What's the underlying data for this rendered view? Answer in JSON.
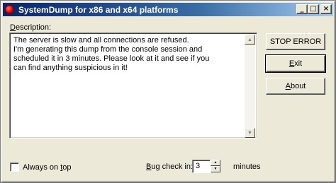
{
  "window": {
    "title": "SystemDump for x86 and x64 platforms",
    "controls": {
      "minimize": "_",
      "maximize": "□",
      "close": "×"
    }
  },
  "description": {
    "label_hotkey": "D",
    "label_rest": "escription:",
    "text": "The server is slow and all connections are refused.\nI'm generating this dump from the console session and\nscheduled it in 3 minutes. Please look at it and see if you\ncan find anything suspicious in it!"
  },
  "buttons": {
    "stop_error": "STOP ERROR",
    "exit_hotkey": "E",
    "exit_rest": "xit",
    "about_hotkey": "A",
    "about_rest": "bout"
  },
  "options": {
    "always_on_top_prefix": "Always on ",
    "always_on_top_hotkey": "t",
    "always_on_top_suffix": "op",
    "always_on_top_checked": false
  },
  "bugcheck": {
    "label_hotkey": "B",
    "label_rest": "ug check in:",
    "value": "3",
    "unit": "minutes"
  },
  "icons": {
    "app": "red-circle-icon",
    "scroll_up": "▲",
    "scroll_down": "▼",
    "spin_up": "▲",
    "spin_down": "▼"
  },
  "colors": {
    "titlebar_start": "#0a246a",
    "titlebar_end": "#a6caf0",
    "window_bg": "#ece9d8",
    "app_icon": "#d00000"
  }
}
